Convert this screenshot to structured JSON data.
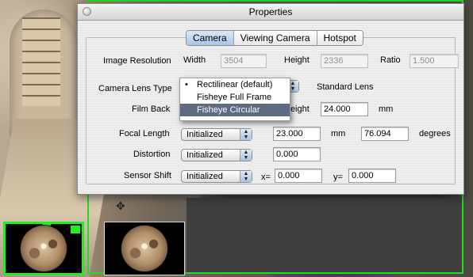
{
  "window": {
    "title": "Properties"
  },
  "tabs": [
    "Camera",
    "Viewing Camera",
    "Hotspot"
  ],
  "image_resolution": {
    "label": "Image Resolution",
    "width_label": "Width",
    "width": "3504",
    "height_label": "Height",
    "height": "2336",
    "ratio_label": "Ratio",
    "ratio": "1.500"
  },
  "lens": {
    "label": "Camera Lens Type",
    "status": "Standard Lens",
    "options": [
      "Rectilinear (default)",
      "Fisheye Full Frame",
      "Fisheye Circular"
    ],
    "checked": "Rectilinear (default)",
    "highlighted": "Fisheye Circular"
  },
  "film_back": {
    "label": "Film Back",
    "height_label": "Height",
    "height": "24.000",
    "unit": "mm"
  },
  "focal_length": {
    "label": "Focal Length",
    "select": "Initialized",
    "value": "23.000",
    "unit": "mm",
    "angle": "76.094",
    "angle_unit": "degrees"
  },
  "distortion": {
    "label": "Distortion",
    "select": "Initialized",
    "value": "0.000"
  },
  "sensor_shift": {
    "label": "Sensor Shift",
    "select": "Initialized",
    "x_label": "x=",
    "x": "0.000",
    "y_label": "y=",
    "y": "0.000"
  },
  "colors": {
    "selection": "#5d6b80",
    "thumbnail_highlight": "#1ef01e"
  },
  "icons": [
    "close-icon",
    "popup-arrows-icon",
    "checkmark-icon"
  ]
}
